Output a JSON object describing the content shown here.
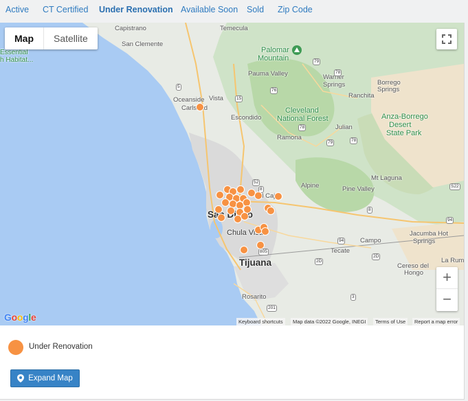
{
  "tabs": [
    {
      "label": "Active"
    },
    {
      "label": "CT Certified"
    },
    {
      "label": "Under Renovation",
      "active": true
    },
    {
      "label": "Available Soon"
    },
    {
      "label": "Sold"
    },
    {
      "label": "Zip Code"
    }
  ],
  "map": {
    "type_controls": {
      "map": "Map",
      "satellite": "Satellite",
      "selected": "Map"
    },
    "zoom": {
      "in": "+",
      "out": "−"
    },
    "places": {
      "capistrano": "Capistrano",
      "temecula": "Temecula",
      "san_clemente": "San Clemente",
      "essential": "Essential",
      "habitat": "h Habitat...",
      "palomar": "Palomar",
      "mountain": "Mountain",
      "pauma_valley": "Pauma Valley",
      "warner": "Warner",
      "springs": "Springs",
      "borrego": "Borrego",
      "borrego_springs": "Springs",
      "oceanside": "Oceanside",
      "carlsbad": "Carlsbad",
      "vista": "Vista",
      "escondido": "Escondido",
      "ranchita": "Ranchita",
      "cleveland": "Cleveland",
      "national_forest": "National Forest",
      "anza": "Anza-Borrego",
      "desert": "Desert",
      "state_park": "State Park",
      "julian": "Julian",
      "ramona": "Ramona",
      "mt_laguna": "Mt Laguna",
      "alpine": "Alpine",
      "pine_valley": "Pine Valley",
      "el_cajon": "El Cajon",
      "san_diego": "San Diego",
      "chula_vista": "Chula Vista",
      "jacumba": "Jacumba Hot",
      "hot_springs": "Springs",
      "campo": "Campo",
      "tecate": "Tecate",
      "tijuana": "Tijuana",
      "cereso": "Cereso del",
      "hongo": "Hongo",
      "la_rumorosa": "La Rumoro",
      "rosarito": "Rosarito"
    },
    "shields": [
      "5",
      "15",
      "79",
      "76",
      "78",
      "78",
      "79",
      "52",
      "8",
      "8",
      "94",
      "94",
      "805",
      "2D",
      "2D",
      "3",
      "201",
      "S22",
      "78"
    ],
    "google_logo": "Google",
    "attribution": {
      "keyboard": "Keyboard shortcuts",
      "data": "Map data ©2022 Google, INEGI",
      "terms": "Terms of Use",
      "report": "Report a map error"
    },
    "marker_color": "#f79243",
    "markers_count_label": ""
  },
  "legend": {
    "label": "Under Renovation",
    "color": "#f79243"
  },
  "expand_button": {
    "label": "Expand Map",
    "icon": "map-marker-icon"
  }
}
